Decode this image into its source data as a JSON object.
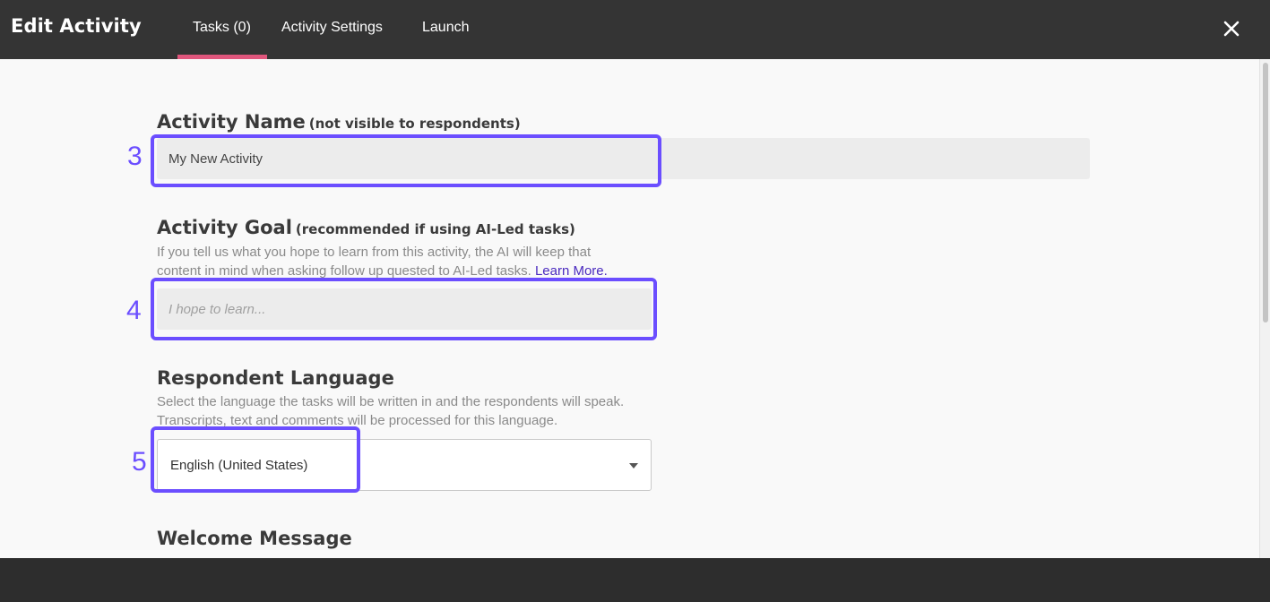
{
  "header": {
    "title": "Edit Activity",
    "tabs": [
      {
        "label": "Tasks (0)",
        "active": true
      },
      {
        "label": "Activity Settings",
        "active": false
      },
      {
        "label": "Launch",
        "active": false
      }
    ],
    "close_icon": "close-icon",
    "accent_color": "#e0567c"
  },
  "form": {
    "activity_name": {
      "title": "Activity Name",
      "subtitle": "(not visible to respondents)",
      "value": "My New Activity"
    },
    "activity_goal": {
      "title": "Activity Goal",
      "subtitle": "(recommended if using AI-Led tasks)",
      "help_line1": "If you tell us what you hope to learn from this activity, the AI will keep that",
      "help_line2": "content in mind when asking follow up quested to AI-Led tasks.",
      "help_link": "Learn More.",
      "placeholder": "I hope to learn..."
    },
    "respondent_language": {
      "title": "Respondent Language",
      "help_line1": "Select the language the tasks will be written in and the respondents will speak.",
      "help_line2": "Transcripts, text and comments will be processed for this language.",
      "selected": "English (United States)"
    },
    "welcome_message": {
      "title": "Welcome Message"
    }
  },
  "annotations": {
    "color": "#6b4eff",
    "steps": [
      "3",
      "4",
      "5"
    ]
  }
}
